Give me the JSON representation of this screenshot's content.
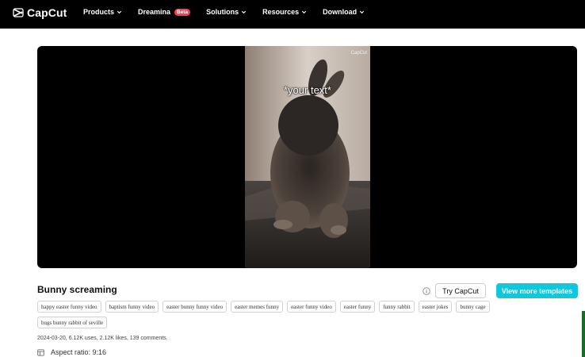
{
  "header": {
    "brand": "CapCut",
    "nav": [
      {
        "label": "Products",
        "has_chevron": true
      },
      {
        "label": "Dreamina",
        "badge": "Beta",
        "has_chevron": false
      },
      {
        "label": "Solutions",
        "has_chevron": true
      },
      {
        "label": "Resources",
        "has_chevron": true
      },
      {
        "label": "Download",
        "has_chevron": true
      }
    ]
  },
  "player": {
    "overlay_text": "*your text*",
    "watermark": "CapCut"
  },
  "template": {
    "title": "Bunny screaming",
    "try_label": "Try CapCut",
    "more_label": "View more templates",
    "tags": [
      "happy easter funny video",
      "baptism funny video",
      "easter bunny funny video",
      "easter memes funny",
      "easter funny video",
      "easter funny",
      "funny rabbit",
      "easter jokes",
      "bunny cage",
      "bugs bunny rabbit of seville"
    ],
    "stats": "2024-03-20, 6.12K uses, 2.12K likes, 139 comments.",
    "aspect_label": "Aspect ratio: 9:16"
  },
  "icons": {
    "logo": "capcut-logo-icon",
    "chevron": "chevron-down-icon",
    "info": "info-icon",
    "aspect": "aspect-ratio-icon"
  },
  "colors": {
    "header_bg": "#000000",
    "accent": "#12c6dc",
    "beta": "#ff3b5c"
  }
}
